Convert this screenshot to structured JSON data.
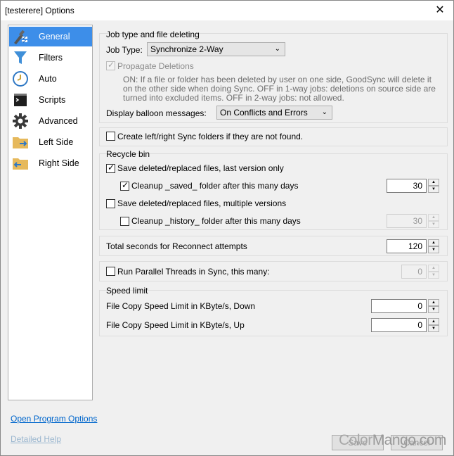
{
  "window": {
    "title": "[testerere] Options",
    "close_symbol": "✕"
  },
  "sidebar": {
    "items": [
      {
        "label": "General",
        "icon": "general-settings-icon",
        "active": true
      },
      {
        "label": "Filters",
        "icon": "funnel-icon"
      },
      {
        "label": "Auto",
        "icon": "clock-icon"
      },
      {
        "label": "Scripts",
        "icon": "terminal-icon"
      },
      {
        "label": "Advanced",
        "icon": "gear-icon"
      },
      {
        "label": "Left Side",
        "icon": "folder-arrow-right-icon"
      },
      {
        "label": "Right Side",
        "icon": "folder-arrow-left-icon"
      }
    ]
  },
  "job": {
    "group_label": "Job type and file deleting",
    "job_type_label": "Job Type:",
    "job_type_value": "Synchronize 2-Way",
    "propagate_label": "Propagate Deletions",
    "propagate_desc": "ON: If a file or folder has been deleted by user on one side, GoodSync will delete it on the other side when doing Sync.  OFF in 1-way jobs: deletions on source side are turned into excluded items. OFF in 2-way jobs: not allowed.",
    "balloon_label": "Display balloon messages:",
    "balloon_value": "On Conflicts and Errors"
  },
  "create_folders": {
    "label": "Create left/right Sync folders if they are not found."
  },
  "recycle": {
    "group_label": "Recycle bin",
    "save_last_label": "Save deleted/replaced files, last version only",
    "cleanup_saved_label": "Cleanup _saved_ folder after this many days",
    "cleanup_saved_days": "30",
    "save_multiple_label": "Save deleted/replaced files, multiple versions",
    "cleanup_history_label": "Cleanup _history_ folder after this many days",
    "cleanup_history_days": "30"
  },
  "reconnect": {
    "label": "Total seconds for Reconnect attempts",
    "value": "120"
  },
  "parallel": {
    "label": "Run Parallel Threads in Sync, this many:",
    "value": "0"
  },
  "speed": {
    "group_label": "Speed limit",
    "down_label": "File Copy Speed Limit in KByte/s, Down",
    "down_value": "0",
    "up_label": "File Copy Speed Limit in KByte/s, Up",
    "up_value": "0"
  },
  "footer": {
    "open_program_options": "Open Program Options",
    "detailed_help": "Detailed Help",
    "save_label": "Save",
    "cancel_label": "Cancel",
    "watermark_a": "Color",
    "watermark_b": "Mango",
    "watermark_c": ".com"
  },
  "colors": {
    "accent": "#3d8ee9",
    "link": "#0066cc"
  }
}
